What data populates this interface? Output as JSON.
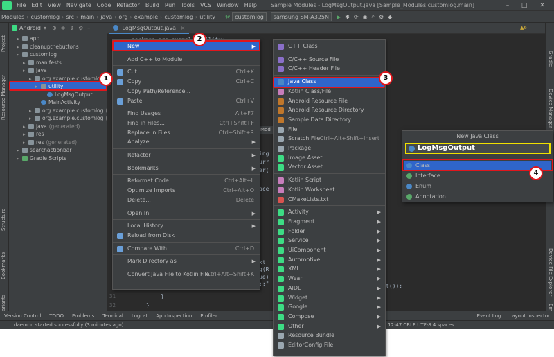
{
  "menubar": {
    "items": [
      "File",
      "Edit",
      "View",
      "Navigate",
      "Code",
      "Refactor",
      "Build",
      "Run",
      "Tools",
      "VCS",
      "Window",
      "Help"
    ],
    "title": "Sample Modules - LogMsgOutput.java [Sample_Modules.customlog.main]"
  },
  "navbar": {
    "crumbs": [
      "Modules",
      "customlog",
      "src",
      "main",
      "java",
      "org",
      "example",
      "customlog",
      "utility"
    ],
    "run_config": "customlog",
    "device": "samsung SM-A325N"
  },
  "project": {
    "view": "Android",
    "tree": [
      {
        "label": "app",
        "depth": 1,
        "icon": "folder"
      },
      {
        "label": "cleanupthebuttons",
        "depth": 1,
        "icon": "folder"
      },
      {
        "label": "customlog",
        "depth": 1,
        "icon": "folder"
      },
      {
        "label": "manifests",
        "depth": 2,
        "icon": "folder"
      },
      {
        "label": "java",
        "depth": 2,
        "icon": "folder"
      },
      {
        "label": "org.example.customlog",
        "depth": 3,
        "icon": "package"
      },
      {
        "label": "utility",
        "depth": 4,
        "icon": "package",
        "selected": true
      },
      {
        "label": "LogMsgOutput",
        "depth": 5,
        "icon": "class"
      },
      {
        "label": "MainActivity",
        "depth": 4,
        "icon": "class"
      },
      {
        "label": "org.example.customlog",
        "suffix": "(andro",
        "depth": 3,
        "icon": "package"
      },
      {
        "label": "org.example.customlog",
        "suffix": "(test)",
        "depth": 3,
        "icon": "package"
      },
      {
        "label": "java",
        "suffix": "(generated)",
        "depth": 2,
        "icon": "folder"
      },
      {
        "label": "res",
        "depth": 2,
        "icon": "folder"
      },
      {
        "label": "res",
        "suffix": "(generated)",
        "depth": 2,
        "icon": "folder"
      },
      {
        "label": "searchactionbar",
        "depth": 1,
        "icon": "folder"
      },
      {
        "label": "Gradle Scripts",
        "depth": 1,
        "icon": "gradle"
      }
    ]
  },
  "editor": {
    "tab": "LogMsgOutput.java",
    "code": [
      {
        "t": "package org.example.utility;"
      },
      {
        "t": "ing"
      },
      {
        "t": "urr"
      },
      {
        "t": "er("
      },
      {
        "t": "ace"
      },
      {
        "t": "xt"
      },
      {
        "t": "g(R"
      },
      {
        "t": "ue)"
      },
      {
        "t": "::\""
      },
      {
        "t": "t());"
      },
      {
        "t": "}"
      },
      {
        "t": "}"
      }
    ],
    "lines": [
      "31",
      "32"
    ]
  },
  "context_menu": {
    "items": [
      {
        "label": "New",
        "arrow": true,
        "hl": true
      },
      {
        "sep": true
      },
      {
        "label": "Add C++ to Module"
      },
      {
        "sep": true
      },
      {
        "label": "Cut",
        "sc": "Ctrl+X",
        "icon": "cut-icon"
      },
      {
        "label": "Copy",
        "sc": "Ctrl+C",
        "icon": "copy-icon"
      },
      {
        "label": "Copy Path/Reference..."
      },
      {
        "label": "Paste",
        "sc": "Ctrl+V",
        "icon": "paste-icon"
      },
      {
        "sep": true
      },
      {
        "label": "Find Usages",
        "sc": "Alt+F7"
      },
      {
        "label": "Find in Files...",
        "sc": "Ctrl+Shift+F"
      },
      {
        "label": "Replace in Files...",
        "sc": "Ctrl+Shift+R"
      },
      {
        "label": "Analyze",
        "arrow": true
      },
      {
        "sep": true
      },
      {
        "label": "Refactor",
        "arrow": true
      },
      {
        "sep": true
      },
      {
        "label": "Bookmarks",
        "arrow": true
      },
      {
        "sep": true
      },
      {
        "label": "Reformat Code",
        "sc": "Ctrl+Alt+L"
      },
      {
        "label": "Optimize Imports",
        "sc": "Ctrl+Alt+O"
      },
      {
        "label": "Delete...",
        "sc": "Delete"
      },
      {
        "sep": true
      },
      {
        "label": "Open In",
        "arrow": true
      },
      {
        "sep": true
      },
      {
        "label": "Local History",
        "arrow": true
      },
      {
        "label": "Reload from Disk",
        "icon": "reload-icon"
      },
      {
        "sep": true
      },
      {
        "label": "Compare With...",
        "sc": "Ctrl+D",
        "icon": "compare-icon"
      },
      {
        "sep": true
      },
      {
        "label": "Mark Directory as",
        "arrow": true
      },
      {
        "sep": true
      },
      {
        "label": "Convert Java File to Kotlin File",
        "sc": "Ctrl+Alt+Shift+K"
      }
    ]
  },
  "new_menu": {
    "items": [
      {
        "label": "C++ Class",
        "color": "#8a6fc9"
      },
      {
        "sep": true
      },
      {
        "label": "C/C++ Source File",
        "color": "#8a6fc9"
      },
      {
        "label": "C/C++ Header File",
        "color": "#8a6fc9"
      },
      {
        "sep": true
      },
      {
        "label": "Java Class",
        "color": "#4a88c7",
        "hl": true
      },
      {
        "label": "Kotlin Class/File",
        "color": "#c77dbb"
      },
      {
        "label": "Android Resource File",
        "color": "#c0772b"
      },
      {
        "label": "Android Resource Directory",
        "color": "#c0772b"
      },
      {
        "label": "Sample Data Directory",
        "color": "#c0772b"
      },
      {
        "label": "File",
        "color": "#9aa7b0"
      },
      {
        "label": "Scratch File",
        "sc": "Ctrl+Alt+Shift+Insert",
        "color": "#9aa7b0"
      },
      {
        "label": "Package",
        "color": "#9aa7b0"
      },
      {
        "label": "Image Asset",
        "color": "#3ddc84"
      },
      {
        "label": "Vector Asset",
        "color": "#3ddc84"
      },
      {
        "sep": true
      },
      {
        "label": "Kotlin Script",
        "color": "#c77dbb"
      },
      {
        "label": "Kotlin Worksheet",
        "color": "#c77dbb"
      },
      {
        "label": "CMakeLists.txt",
        "color": "#d9534f"
      },
      {
        "sep": true
      },
      {
        "label": "Activity",
        "arrow": true,
        "color": "#3ddc84"
      },
      {
        "label": "Fragment",
        "arrow": true,
        "color": "#3ddc84"
      },
      {
        "label": "Folder",
        "arrow": true,
        "color": "#3ddc84"
      },
      {
        "label": "Service",
        "arrow": true,
        "color": "#3ddc84"
      },
      {
        "label": "UiComponent",
        "arrow": true,
        "color": "#3ddc84"
      },
      {
        "label": "Automotive",
        "arrow": true,
        "color": "#3ddc84"
      },
      {
        "label": "XML",
        "arrow": true,
        "color": "#3ddc84"
      },
      {
        "label": "Wear",
        "arrow": true,
        "color": "#3ddc84"
      },
      {
        "label": "AIDL",
        "arrow": true,
        "color": "#3ddc84"
      },
      {
        "label": "Widget",
        "arrow": true,
        "color": "#3ddc84"
      },
      {
        "label": "Google",
        "arrow": true,
        "color": "#3ddc84"
      },
      {
        "label": "Compose",
        "arrow": true,
        "color": "#3ddc84"
      },
      {
        "label": "Other",
        "arrow": true,
        "color": "#3ddc84"
      },
      {
        "label": "Resource Bundle",
        "color": "#9aa7b0"
      },
      {
        "label": "EditorConfig File",
        "color": "#9aa7b0"
      }
    ]
  },
  "dialog": {
    "title": "New Java Class",
    "input_value": "LogMsgOutput",
    "options": [
      {
        "label": "Class",
        "color": "#4a88c7",
        "hl": true
      },
      {
        "label": "Interface",
        "color": "#59a869"
      },
      {
        "label": "Enum",
        "color": "#4a88c7"
      },
      {
        "label": "Annotation",
        "color": "#59a869"
      }
    ]
  },
  "badges": [
    "1",
    "2",
    "3",
    "4"
  ],
  "side_tabs": {
    "left": [
      "Project",
      "Resource Manager",
      "Structure",
      "Bookmarks",
      "Build Variants"
    ],
    "right": [
      "Gradle",
      "Device Manager",
      "Device File Explorer",
      "Emulator"
    ]
  },
  "bottom_tabs": [
    "Version Control",
    "TODO",
    "Problems",
    "Terminal",
    "Logcat",
    "App Inspection",
    "Profiler",
    "Event Log",
    "Layout Inspector"
  ],
  "status": {
    "message": "daemon started successfully (3 minutes ago)",
    "right": "12:47  CRLF  UTF-8  4 spaces"
  },
  "warnings": "▲6",
  "partial_tab": "Mod"
}
